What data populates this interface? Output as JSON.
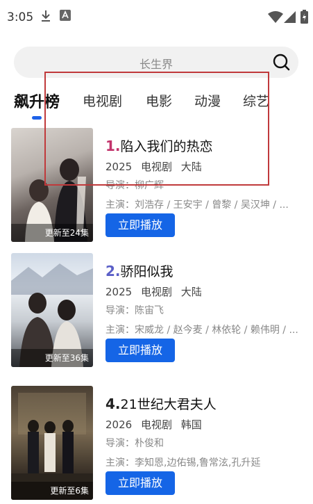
{
  "status_bar": {
    "time": "3:05"
  },
  "search": {
    "placeholder": "长生界"
  },
  "tabs": [
    {
      "label": "飙升榜",
      "active": true
    },
    {
      "label": "电视剧"
    },
    {
      "label": "电影"
    },
    {
      "label": "动漫"
    },
    {
      "label": "综艺"
    }
  ],
  "items": [
    {
      "rank": "1.",
      "rank_color": "#c2336b",
      "title": "陷入我们的热恋",
      "year": "2025",
      "category": "电视剧",
      "region": "大陆",
      "director": "导演：柳广辉",
      "cast": "主演：刘浩存 / 王安宇 / 曾黎 / 吴汉坤 / ...",
      "badge": "更新至24集",
      "play_label": "立即播放"
    },
    {
      "rank": "2.",
      "rank_color": "#5b5fc7",
      "title": "骄阳似我",
      "year": "2025",
      "category": "电视剧",
      "region": "大陆",
      "director": "导演：陈宙飞",
      "cast": "主演：宋威龙 / 赵今麦 / 林依轮 / 赖伟明 / ...",
      "badge": "更新至36集",
      "play_label": "立即播放"
    },
    {
      "rank": "4.",
      "rank_color": "#222222",
      "title": "21世纪大君夫人",
      "year": "2026",
      "category": "电视剧",
      "region": "韩国",
      "director": "导演：朴俊和",
      "cast": "主演：李知恩,边佑锡,鲁常泫,孔升延",
      "badge": "更新至6集",
      "play_label": "立即播放"
    }
  ],
  "colors": {
    "accent": "#1565e6",
    "overlay": "#c0393b"
  }
}
